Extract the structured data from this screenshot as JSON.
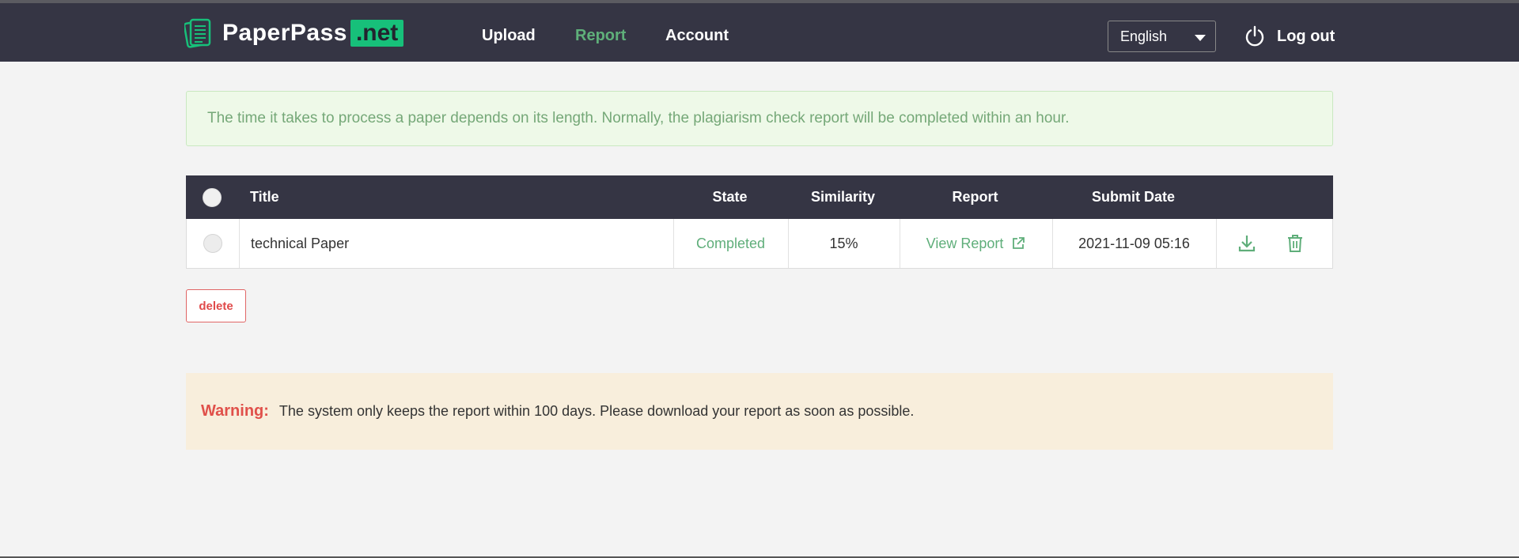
{
  "brand": {
    "name": "PaperPass",
    "suffix": ".net"
  },
  "nav": [
    {
      "label": "Upload",
      "active": false
    },
    {
      "label": "Report",
      "active": true
    },
    {
      "label": "Account",
      "active": false
    }
  ],
  "language": {
    "selected": "English"
  },
  "logout_label": "Log out",
  "notice": "The time it takes to process a paper depends on its length. Normally, the plagiarism check report will be completed within an hour.",
  "table": {
    "headers": [
      "Title",
      "State",
      "Similarity",
      "Report",
      "Submit Date"
    ],
    "rows": [
      {
        "title": "technical Paper",
        "state": "Completed",
        "similarity": "15%",
        "report": "View Report",
        "submit_date": "2021-11-09 05:16"
      }
    ]
  },
  "delete_label": "delete",
  "warning": {
    "label": "Warning:",
    "text": "The system only keeps the report within 100 days. Please download your report as soon as possible."
  },
  "colors": {
    "header_bg": "#353544",
    "accent_green": "#5fae7a",
    "brand_green": "#17c07a",
    "warning_red": "#e0504a"
  }
}
